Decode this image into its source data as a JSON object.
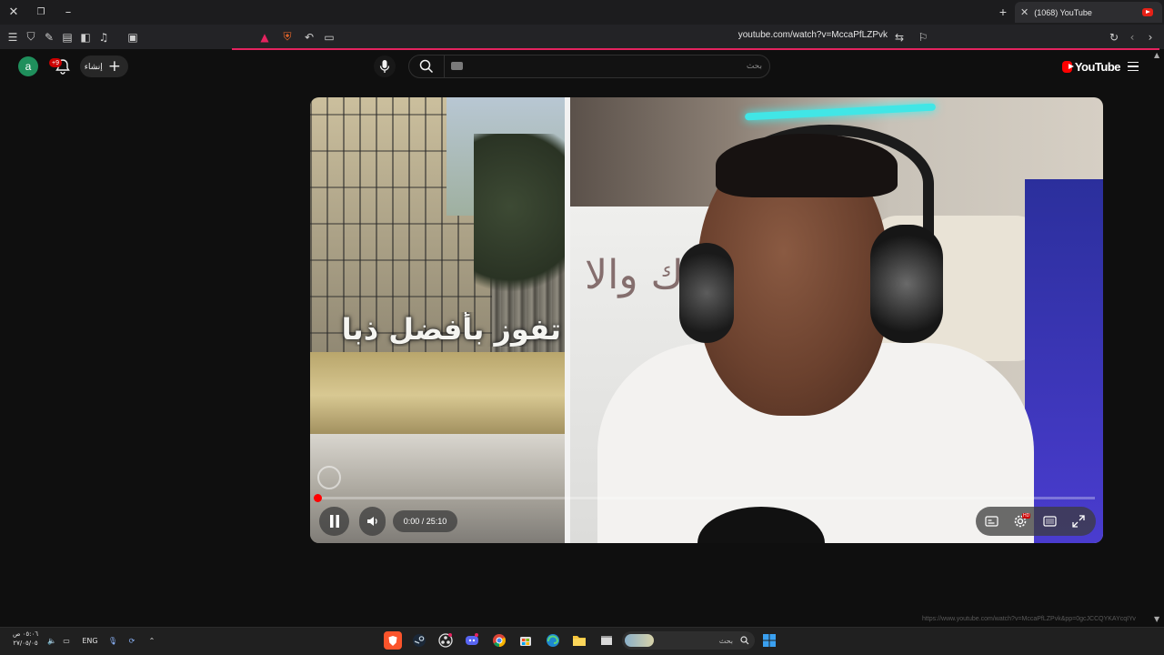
{
  "browser": {
    "tab_title": "(1068) YouTube",
    "url": "youtube.com/watch?v=MccaPfLZPvk",
    "status_url": "https://www.youtube.com/watch?v=MccaPfLZPvk&pp=0gcJCCQYKAYcqIYv"
  },
  "youtube": {
    "avatar_letter": "a",
    "notifications_count": "+9",
    "create_label": "إنشاء",
    "search_placeholder": "بحث",
    "logo_text": "YouTube"
  },
  "video": {
    "caption_overlay": "تفوز بأفضل ذبا",
    "board_text": "تراك والا",
    "time_display": "0:00 / 25:10",
    "progress_fraction": 0.0,
    "quality_badge": "HD"
  },
  "taskbar": {
    "clock_time": "٠٥:٠٦ ص",
    "clock_date": "٢٧/٠٥/٠٥",
    "language": "ENG",
    "search_placeholder": "بحث"
  },
  "colors": {
    "accent": "#e4235f",
    "youtube_red": "#ff0000",
    "background": "#0f0f0f"
  }
}
